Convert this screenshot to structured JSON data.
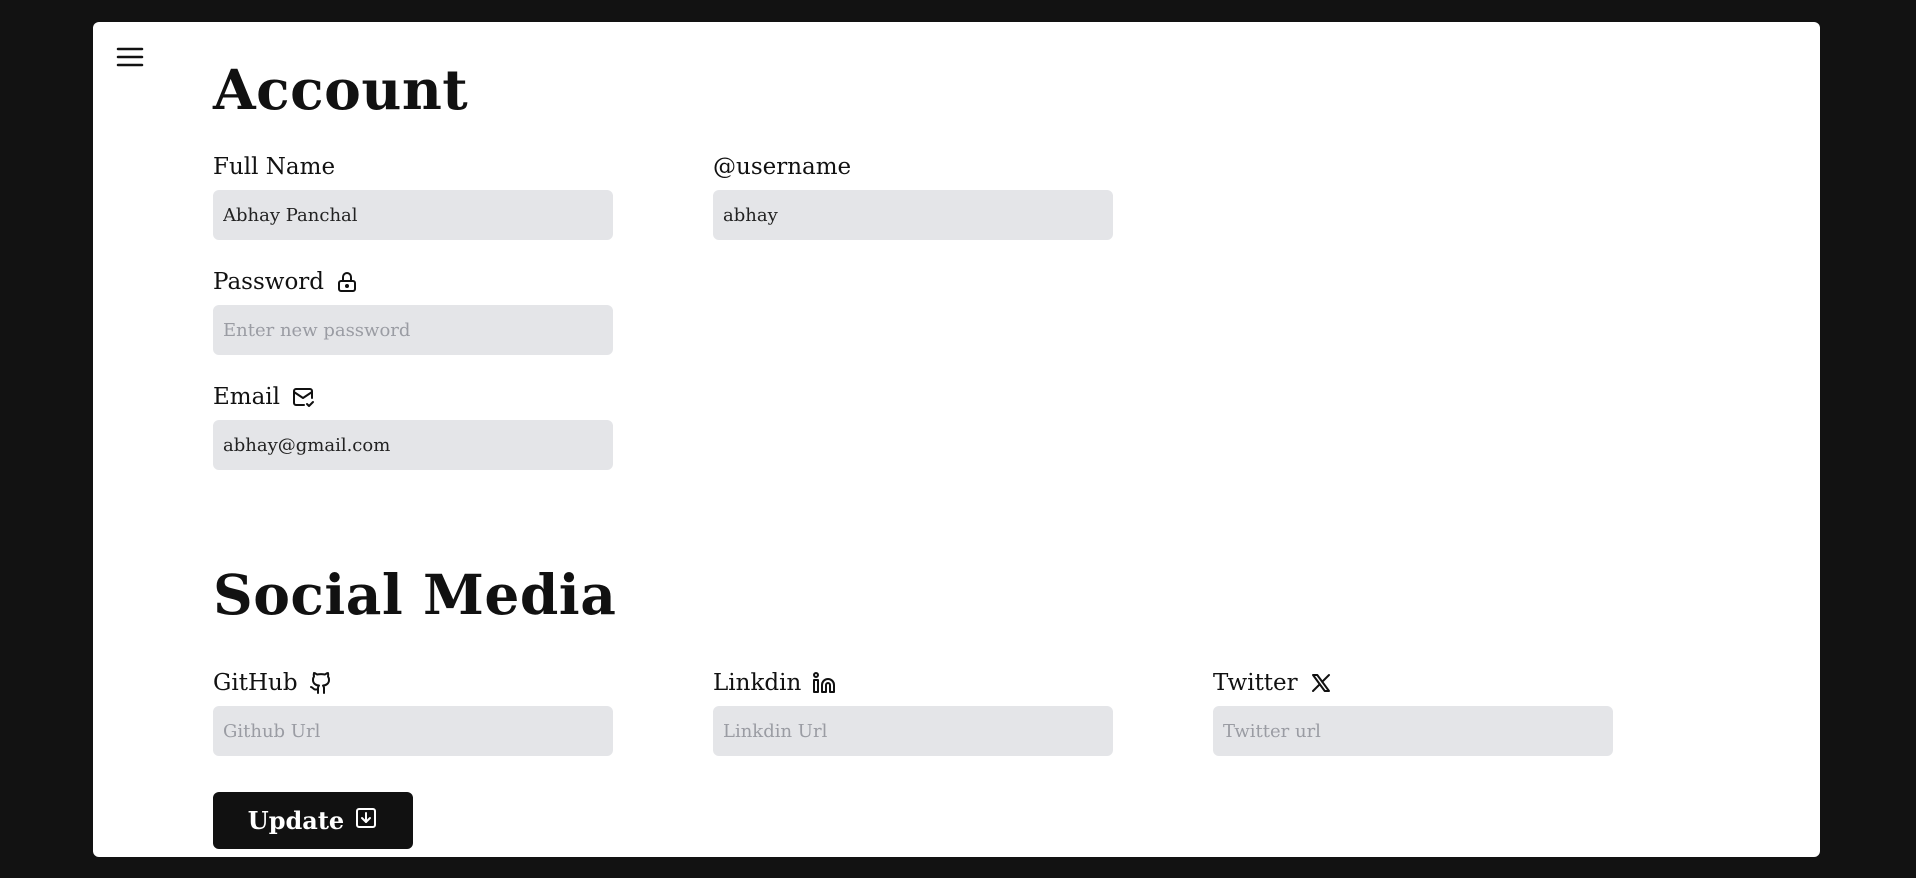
{
  "account": {
    "title": "Account",
    "full_name": {
      "label": "Full Name",
      "value": "Abhay Panchal",
      "placeholder": ""
    },
    "username": {
      "label": "@username",
      "value": "abhay",
      "placeholder": ""
    },
    "password": {
      "label": "Password",
      "value": "",
      "placeholder": "Enter new password",
      "icon": "lock-icon"
    },
    "email": {
      "label": "Email",
      "value": "abhay@gmail.com",
      "placeholder": "",
      "icon": "mail-check-icon"
    }
  },
  "social": {
    "title": "Social Media",
    "github": {
      "label": "GitHub",
      "value": "",
      "placeholder": "Github Url",
      "icon": "github-icon"
    },
    "linkedin": {
      "label": "Linkdin",
      "value": "",
      "placeholder": "Linkdin Url",
      "icon": "linkedin-icon"
    },
    "twitter": {
      "label": "Twitter",
      "value": "",
      "placeholder": "Twitter url",
      "icon": "x-icon"
    }
  },
  "actions": {
    "update_label": "Update",
    "update_icon": "save-icon"
  },
  "colors": {
    "page_bg": "#121212",
    "card_bg": "#ffffff",
    "input_bg": "#e4e5e8",
    "button_bg": "#111111",
    "button_text": "#ffffff"
  }
}
